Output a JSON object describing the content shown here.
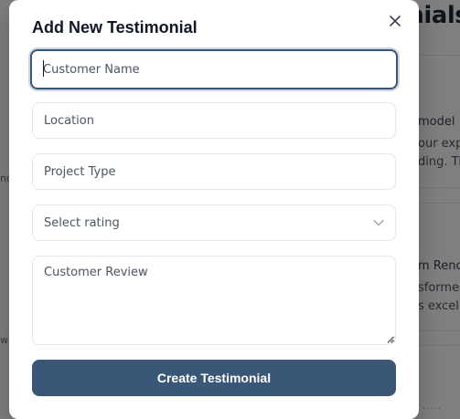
{
  "background": {
    "title_fragment": "onials",
    "row1": [
      "model",
      "our exp",
      "ding. Th"
    ],
    "row2": [
      "m Reno",
      "sformed",
      "s excelle"
    ],
    "left_fragments": [
      "no",
      "wh"
    ],
    "dots": "....."
  },
  "modal": {
    "title": "Add New Testimonial",
    "customer_name_placeholder": "Customer Name",
    "location_placeholder": "Location",
    "project_type_placeholder": "Project Type",
    "rating_label": "Select rating",
    "review_placeholder": "Customer Review",
    "submit_label": "Create Testimonial"
  },
  "colors": {
    "primary": "#3b5778",
    "overlay": "rgba(0,0,0,0.5)"
  },
  "icons": [
    "close-icon",
    "chevron-down-icon",
    "resize-grip-icon"
  ]
}
